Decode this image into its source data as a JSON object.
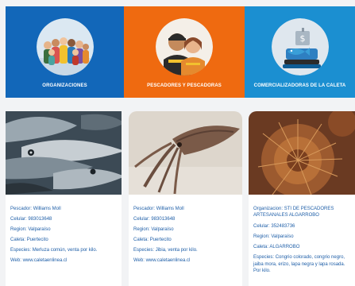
{
  "tabs": [
    {
      "label": "ORGANIZACIONES",
      "bg": "#1267b9",
      "icon": "group-people-icon"
    },
    {
      "label": "PESCADORES Y PESCADORAS",
      "bg": "#ef6a10",
      "icon": "fishers-icon"
    },
    {
      "label": "COMERCIALIZADORAS DE LA CALETA",
      "bg": "#1b8fd1",
      "icon": "fish-market-icon"
    }
  ],
  "cards": [
    {
      "image": "fish-photo",
      "fields": [
        {
          "label": "Pescador:",
          "value": "Williams Moll"
        },
        {
          "label": "Celular:",
          "value": "983013648"
        },
        {
          "label": "Region:",
          "value": "Valparaíso"
        },
        {
          "label": "Caleta:",
          "value": "Puertecito"
        },
        {
          "label": "Especies:",
          "value": "Merluza común, venta por kilo."
        },
        {
          "label": "Web:",
          "value": "www.caletaenlinea.cl"
        }
      ]
    },
    {
      "image": "squid-photo",
      "fields": [
        {
          "label": "Pescador:",
          "value": "Williams Moll"
        },
        {
          "label": "Celular:",
          "value": "983013648"
        },
        {
          "label": "Region:",
          "value": "Valparaíso"
        },
        {
          "label": "Caleta:",
          "value": "Puertecito"
        },
        {
          "label": "Especies:",
          "value": "Jibia, venta por kilo."
        },
        {
          "label": "Web:",
          "value": "www.caletaenlinea.cl"
        }
      ]
    },
    {
      "image": "sea-urchin-photo",
      "fields": [
        {
          "label": "Organizacion:",
          "value": "STI DE PESCADORES ARTESANALES ALGARROBO"
        },
        {
          "label": "Celular:",
          "value": "352483736"
        },
        {
          "label": "Region:",
          "value": "Valparaíso"
        },
        {
          "label": "Caleta:",
          "value": "ALGARROBO"
        },
        {
          "label": "Especies:",
          "value": "Congrio colorado, congrio negro, jaiba mora, erizo, lapa negra y lapa rosada. Por kilo."
        }
      ]
    }
  ]
}
